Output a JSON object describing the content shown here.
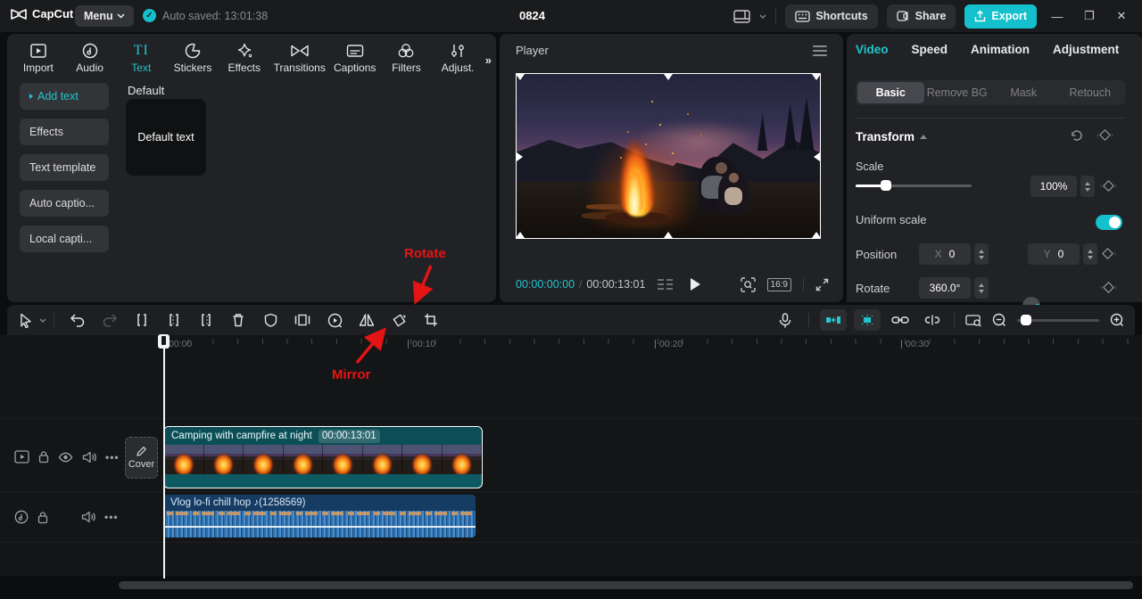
{
  "colors": {
    "accent": "#23c4ce",
    "export_button": "#14c0cb",
    "annotation_red": "#e51414",
    "video_clip_teal": "#0e5a62",
    "audio_clip_blue": "#16416e"
  },
  "topbar": {
    "logo": "CapCut",
    "menu": "Menu",
    "autosaved": "Auto saved: 13:01:38",
    "doc_title": "0824",
    "shortcuts": "Shortcuts",
    "share": "Share",
    "export": "Export"
  },
  "media": {
    "tools": [
      "Import",
      "Audio",
      "Text",
      "Stickers",
      "Effects",
      "Transitions",
      "Captions",
      "Filters",
      "Adjust."
    ],
    "text_icon": "TI",
    "sidebar": [
      "Add text",
      "Effects",
      "Text template",
      "Auto captio...",
      "Local capti..."
    ],
    "section_title": "Default",
    "card_label": "Default text"
  },
  "player": {
    "title": "Player",
    "current_time": "00:00:00:00",
    "separator": "/",
    "duration": "00:00:13:01",
    "ratio": "16:9"
  },
  "inspector": {
    "tabs": [
      "Video",
      "Speed",
      "Animation",
      "Adjustment"
    ],
    "subtabs": [
      "Basic",
      "Remove BG",
      "Mask",
      "Retouch"
    ],
    "transform_title": "Transform",
    "scale_label": "Scale",
    "scale_value": "100%",
    "uniform_label": "Uniform scale",
    "position_label": "Position",
    "x_label": "X",
    "x_value": "0",
    "y_label": "Y",
    "y_value": "0",
    "rotate_label": "Rotate",
    "rotate_value": "360.0°"
  },
  "timeline": {
    "ruler": [
      "00:00",
      "00:10",
      "00:20",
      "00:30"
    ],
    "cover_label": "Cover",
    "video_clip": {
      "title": "Camping with campfire at night",
      "duration": "00:00:13:01"
    },
    "audio_clip": {
      "title": "Vlog  lo-fi chill hop ♪(1258569)"
    }
  },
  "annotations": {
    "rotate": "Rotate",
    "mirror": "Mirror"
  }
}
